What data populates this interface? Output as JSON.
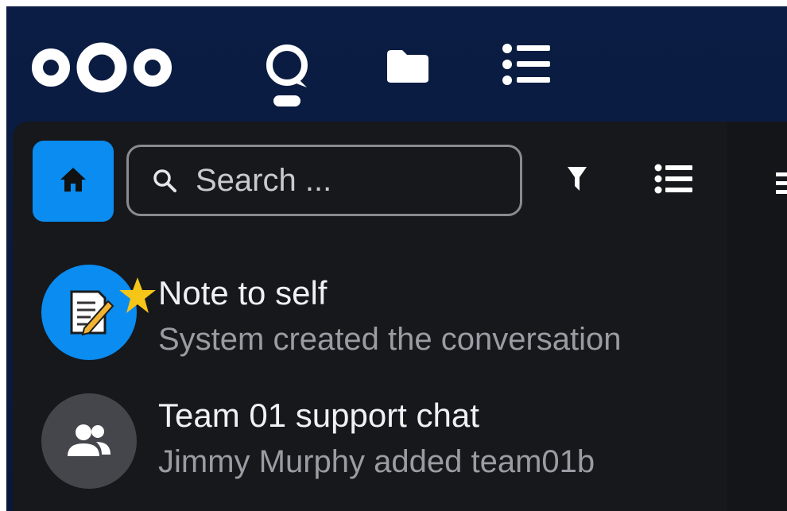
{
  "header": {
    "apps": [
      {
        "name": "talk",
        "icon": "talk-icon"
      },
      {
        "name": "files",
        "icon": "folder-icon"
      },
      {
        "name": "activity",
        "icon": "activity-list-icon"
      }
    ]
  },
  "sidebar": {
    "home_icon": "home-icon",
    "search": {
      "placeholder": "Search ...",
      "value": ""
    },
    "filter_icon": "filter-icon",
    "list_icon": "list-icon"
  },
  "conversations": [
    {
      "title": "Note to self",
      "subtitle": "System created the conversation",
      "favorite": true,
      "avatar_icon": "note-to-self-icon",
      "avatar_color": "#0a8cf0"
    },
    {
      "title": "Team 01 support chat",
      "subtitle": "Jimmy Murphy added team01b",
      "favorite": false,
      "avatar_icon": "group-icon",
      "avatar_color": "#45464c"
    }
  ],
  "colors": {
    "header_bg": "#0b1d44",
    "panel_bg": "#17181c",
    "primary": "#0a8cf0",
    "favorite_star": "#f5c518"
  }
}
